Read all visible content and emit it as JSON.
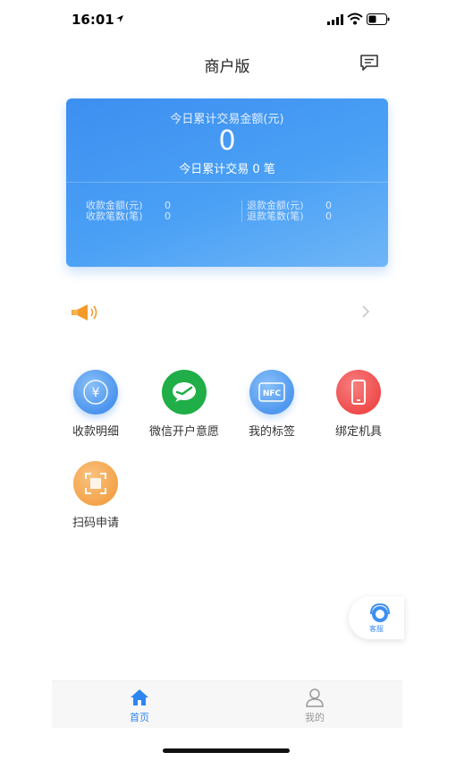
{
  "status_bar": {
    "time": "16:01"
  },
  "nav": {
    "title": "商户版",
    "message_icon": "message-icon"
  },
  "summary_card": {
    "amount_label": "今日累计交易金额(元)",
    "amount_value": "0",
    "count_text": "今日累计交易 0 笔",
    "collect_amount_label": "收款金额(元)",
    "collect_amount_value": "0",
    "collect_count_label": "收款笔数(笔)",
    "collect_count_value": "0",
    "refund_amount_label": "退款金额(元)",
    "refund_amount_value": "0",
    "refund_count_label": "退款笔数(笔)",
    "refund_count_value": "0",
    "colors": {
      "gradient_start": "#3d8ff0",
      "gradient_end": "#6fb6f7"
    }
  },
  "notice": {
    "icon": "speaker-icon"
  },
  "grid": {
    "items": [
      {
        "label": "收款明细",
        "icon": "yen-icon",
        "color": "#4b94ee"
      },
      {
        "label": "微信开户意愿",
        "icon": "wechat-icon",
        "color": "#1fae47"
      },
      {
        "label": "我的标签",
        "icon": "nfc-icon",
        "color": "#4f98ef"
      },
      {
        "label": "绑定机具",
        "icon": "phone-icon",
        "color": "#ef4b4b"
      },
      {
        "label": "扫码申请",
        "icon": "scan-icon",
        "color": "#f4a34a"
      }
    ],
    "nfc_text": "NFC",
    "yen_text": "¥"
  },
  "customer_service": {
    "label": "客服"
  },
  "tabbar": {
    "tabs": [
      {
        "label": "首页",
        "icon": "home-icon",
        "active": true
      },
      {
        "label": "我的",
        "icon": "user-icon",
        "active": false
      }
    ],
    "active_color": "#2f86f0",
    "inactive_color": "#999999"
  }
}
